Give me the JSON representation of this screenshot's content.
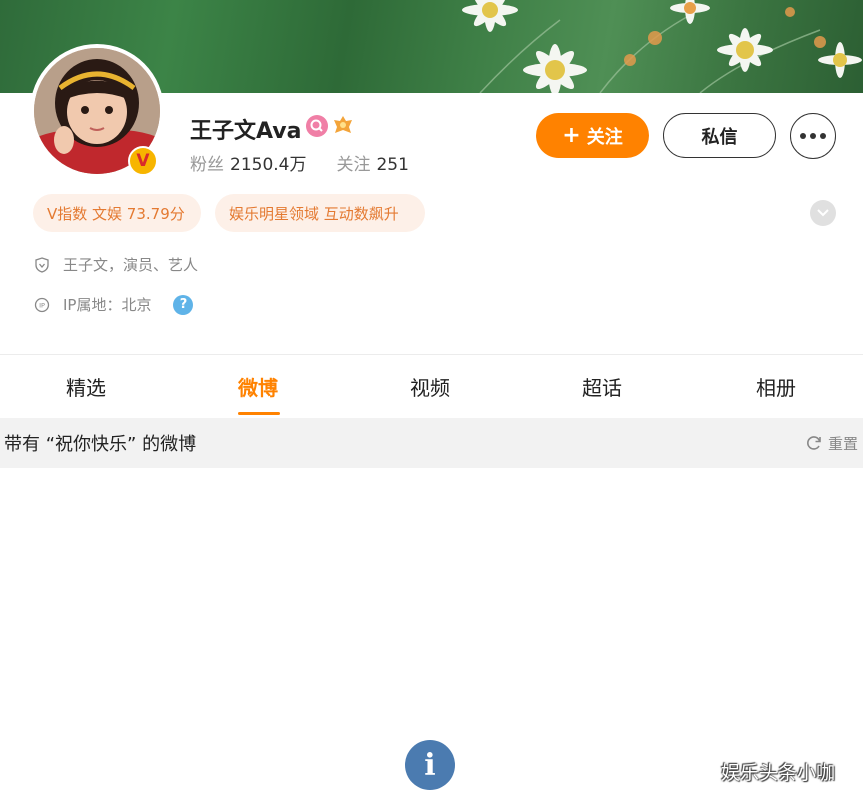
{
  "profile": {
    "name": "王子文Ava",
    "fans_label": "粉丝",
    "fans_count": "2150.4万",
    "following_label": "关注",
    "following_count": "251",
    "verified_mark": "V"
  },
  "actions": {
    "follow_icon": "+",
    "follow_label": "关注",
    "message_label": "私信",
    "more_icon": "more-dots-icon"
  },
  "tags": [
    {
      "label": "V指数 文娱 73.79分"
    },
    {
      "label": "娱乐明星领域 互动数飙升"
    }
  ],
  "info": {
    "verification": "王子文，演员、艺人",
    "ip_location": "IP属地：北京",
    "help_icon": "?"
  },
  "tabs": [
    {
      "label": "精选",
      "active": false
    },
    {
      "label": "微博",
      "active": true
    },
    {
      "label": "视频",
      "active": false
    },
    {
      "label": "超话",
      "active": false
    },
    {
      "label": "相册",
      "active": false
    }
  ],
  "filter": {
    "text": "带有 “祝你快乐” 的微博",
    "reset_label": "重置"
  },
  "fab": {
    "label": "i"
  },
  "watermark": "娱乐头条小咖",
  "colors": {
    "accent": "#ff8200",
    "tag_bg": "#fdf0e8",
    "tag_text": "#e47a32",
    "help": "#5fb3e8",
    "fab": "#4b7bb0"
  }
}
